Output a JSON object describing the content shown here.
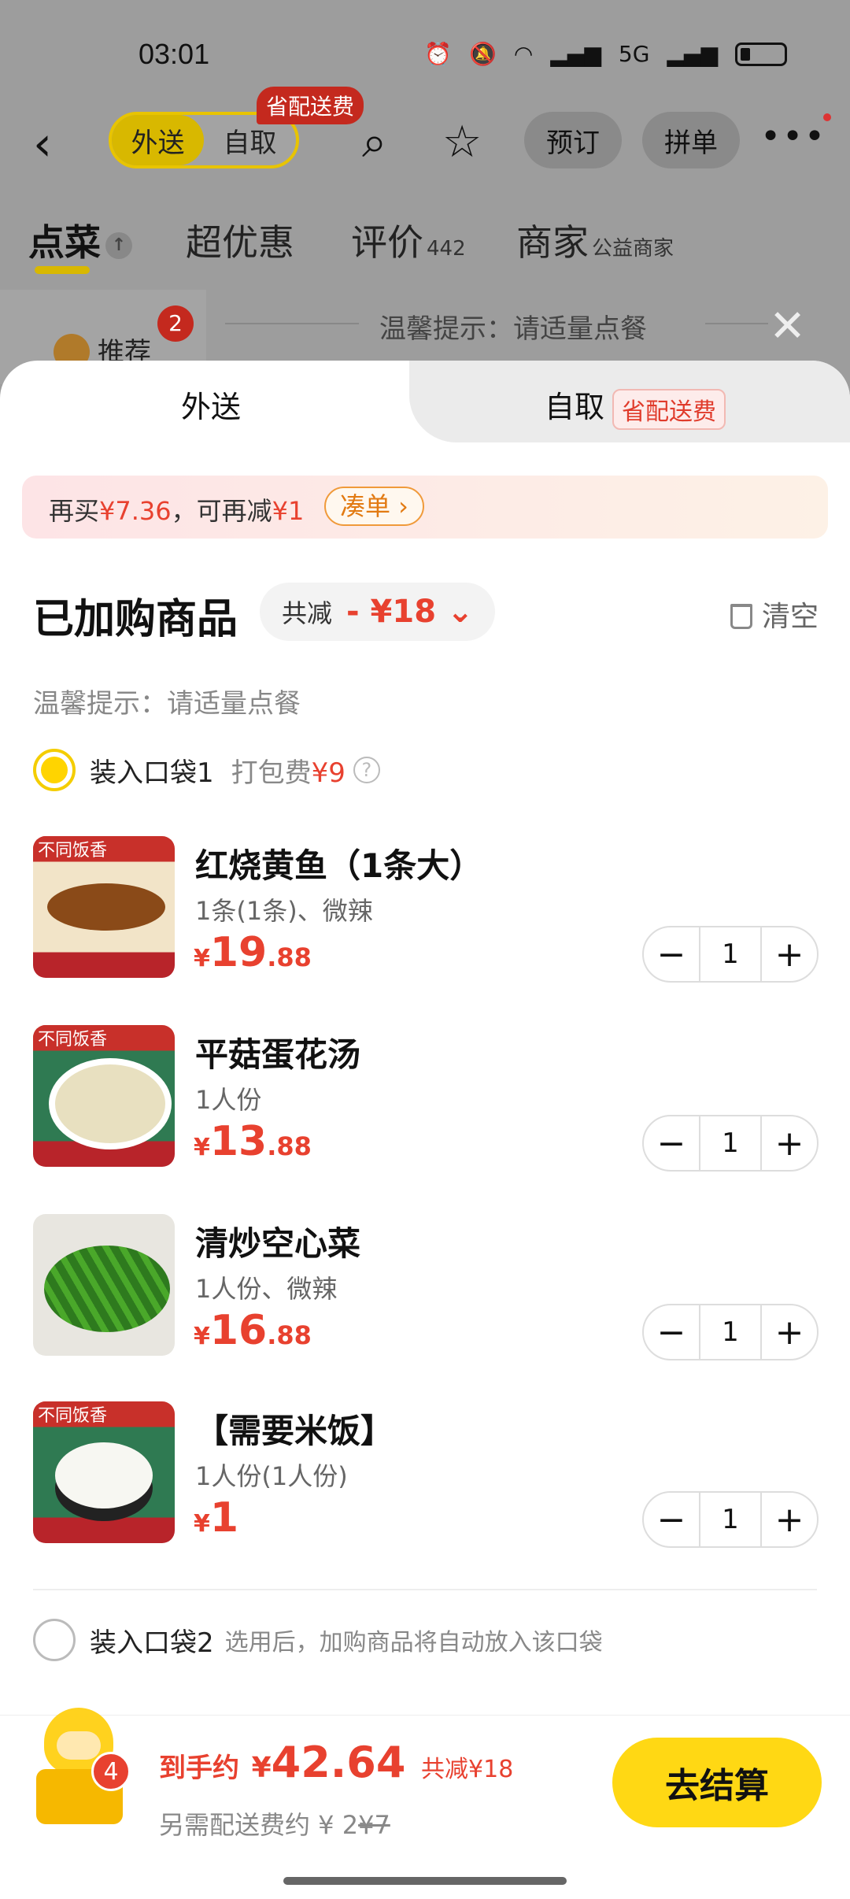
{
  "status_bar": {
    "time": "03:01",
    "network": "5G"
  },
  "nav": {
    "mode_delivery": "外送",
    "mode_pickup": "自取",
    "save_badge": "省配送费",
    "reserve_btn": "预订",
    "group_btn": "拼单"
  },
  "tabs": {
    "order": "点菜",
    "deals": "超优惠",
    "reviews": "评价",
    "reviews_count": "442",
    "merchant": "商家",
    "merchant_tag": "公益商家"
  },
  "sidebar": {
    "recommend": "推荐",
    "recommend_badge": "2"
  },
  "bg_tip": "温馨提示：请适量点餐",
  "sheet": {
    "tab_delivery": "外送",
    "tab_pickup": "自取",
    "tab_pickup_badge": "省配送费",
    "promo_prefix": "再买",
    "promo_amount": "¥7.36",
    "promo_mid": "，可再减",
    "promo_discount": "¥1",
    "promo_btn": "凑单 ›",
    "title": "已加购商品",
    "total_discount_label": "共减",
    "total_discount_value": "- ¥18 ⌄",
    "clear": "清空",
    "tip": "温馨提示：请适量点餐",
    "bag1_label": "装入口袋1",
    "bag1_fee_label": "打包费",
    "bag1_fee": "¥9",
    "bag2_label": "装入口袋2",
    "bag2_hint": "选用后，加购商品将自动放入该口袋"
  },
  "items": [
    {
      "name": "红烧黄鱼（1条大）",
      "spec": "1条(1条)、微辣",
      "cur": "¥",
      "price_int": "19",
      "price_dec": ".88",
      "qty": "1",
      "thumb_tag": "不同饭香"
    },
    {
      "name": "平菇蛋花汤",
      "spec": "1人份",
      "cur": "¥",
      "price_int": "13",
      "price_dec": ".88",
      "qty": "1",
      "thumb_tag": "不同饭香"
    },
    {
      "name": "清炒空心菜",
      "spec": "1人份、微辣",
      "cur": "¥",
      "price_int": "16",
      "price_dec": ".88",
      "qty": "1",
      "thumb_tag": ""
    },
    {
      "name": "【需要米饭】",
      "spec": "1人份(1人份)",
      "cur": "¥",
      "price_int": "1",
      "price_dec": "",
      "qty": "1",
      "thumb_tag": "不同饭香"
    }
  ],
  "footer": {
    "cart_count": "4",
    "pay_label": "到手约",
    "pay_cur": "¥",
    "pay_amount": "42.64",
    "pay_saved": "共减¥18",
    "delivery_prefix": "另需配送费约 ¥ 2",
    "delivery_orig": "¥7",
    "checkout": "去结算"
  },
  "colors": {
    "accent": "#ffd814",
    "price": "#e8412f"
  }
}
